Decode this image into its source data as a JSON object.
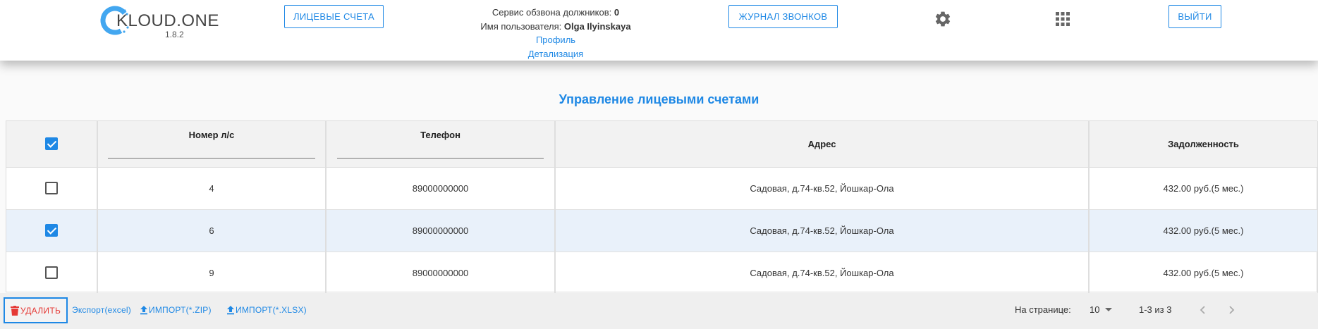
{
  "header": {
    "logo_text": "KLOUD.ONE",
    "version": "1.8.2",
    "accounts_button": "ЛИЦЕВЫЕ СЧЕТА",
    "journal_button": "ЖУРНАЛ ЗВОНКОВ",
    "logout_button": "ВЫЙТИ",
    "service_label": "Сервис обзвона должников:",
    "service_value": "0",
    "user_label": "Имя пользователя:",
    "user_value": "Olga Ilyinskaya",
    "profile_link": "Профиль",
    "details_link": "Детализация"
  },
  "page_title": "Управление лицевыми счетами",
  "table": {
    "columns": [
      "Номер л/с",
      "Телефон",
      "Адрес",
      "Задолженность"
    ],
    "select_all_checked": true,
    "rows": [
      {
        "checked": false,
        "account": "4",
        "phone": "89000000000",
        "address": "Садовая, д.74-кв.52, Йошкар-Ола",
        "debt": "432.00 руб.(5 мес.)"
      },
      {
        "checked": true,
        "account": "6",
        "phone": "89000000000",
        "address": "Садовая, д.74-кв.52, Йошкар-Ола",
        "debt": "432.00 руб.(5 мес.)"
      },
      {
        "checked": false,
        "account": "9",
        "phone": "89000000000",
        "address": "Садовая, д.74-кв.52, Йошкар-Ола",
        "debt": "432.00 руб.(5 мес.)"
      }
    ]
  },
  "footer": {
    "delete_button": "УДАЛИТЬ",
    "export_link": "Экспорт(excel)",
    "import_zip": "ИМПОРТ(*.ZIP)",
    "import_xlsx": "ИМПОРТ(*.XLSX)",
    "per_page_label": "На странице:",
    "per_page_value": "10",
    "range_text": "1-3 из 3"
  },
  "icons": {
    "settings": "gear-icon",
    "apps": "apps-grid-icon",
    "delete": "trash-icon",
    "upload": "upload-icon",
    "prev": "chevron-left-icon",
    "next": "chevron-right-icon"
  },
  "colors": {
    "accent": "#1e88e5",
    "danger": "#e53935",
    "selected_row": "#e9f1fa"
  }
}
